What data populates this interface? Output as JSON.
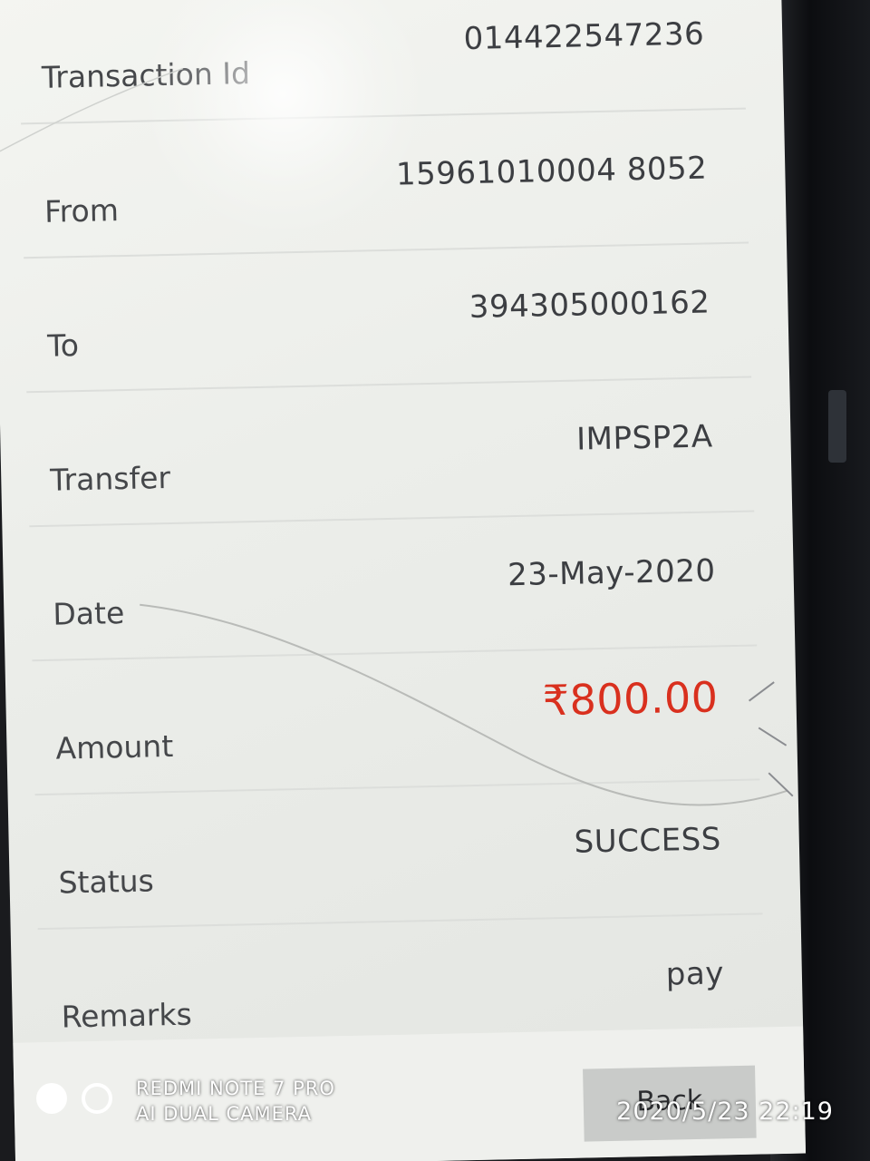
{
  "transaction": {
    "rows": [
      {
        "label": "Transaction Id",
        "value": "014422547236"
      },
      {
        "label": "From",
        "value": "15961010004 8052"
      },
      {
        "label": "To",
        "value": "394305000162"
      },
      {
        "label": "Transfer",
        "value": "IMPSP2A"
      },
      {
        "label": "Date",
        "value": "23-May-2020"
      },
      {
        "label": "Amount",
        "value": "₹800.00"
      },
      {
        "label": "Status",
        "value": "SUCCESS"
      },
      {
        "label": "Remarks",
        "value": "pay"
      }
    ],
    "amount_color": "#d9301e"
  },
  "footer": {
    "back_label": "Back"
  },
  "camera_watermark": {
    "line1": "REDMI NOTE 7 PRO",
    "line2": "AI DUAL CAMERA",
    "timestamp": "2020/5/23  22:19"
  }
}
